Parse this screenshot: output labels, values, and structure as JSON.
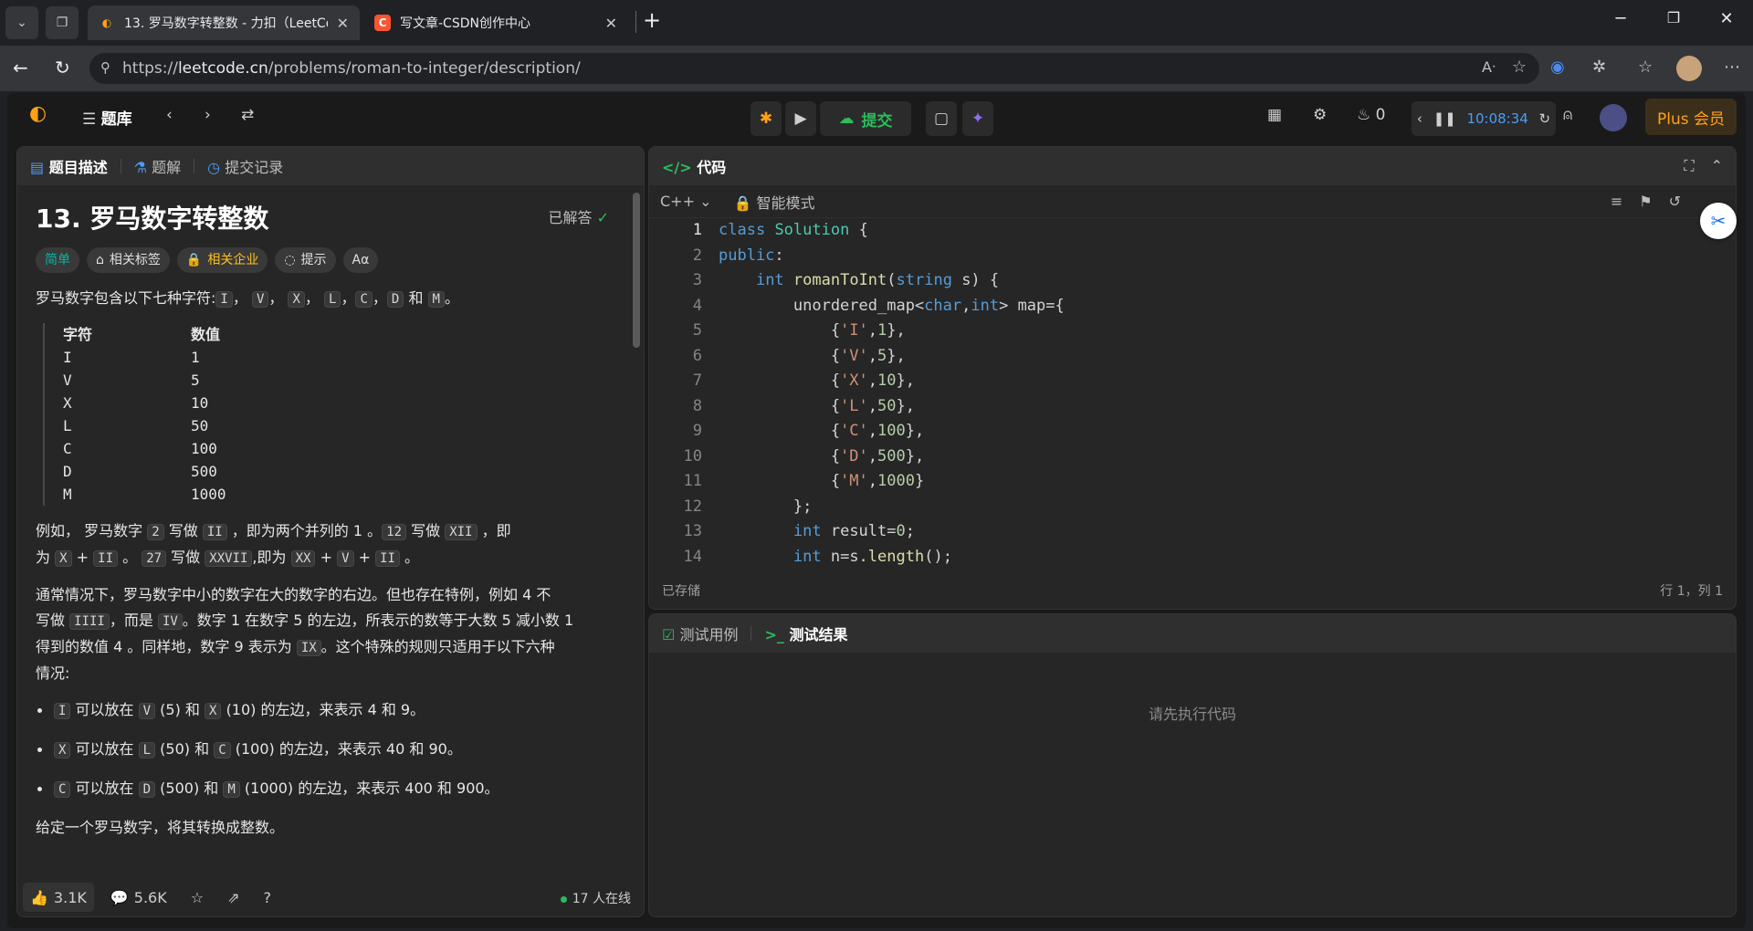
{
  "browser": {
    "tabs": [
      {
        "title": "13. 罗马数字转整数 - 力扣（LeetCode）",
        "icon": "leetcode-icon",
        "active": true
      },
      {
        "title": "写文章-CSDN创作中心",
        "icon": "csdn-icon",
        "active": false
      }
    ],
    "url_prefix": "https://",
    "url_host": "leetcode.cn",
    "url_path": "/problems/roman-to-integer/description/"
  },
  "topnav": {
    "problem_list": "题库",
    "submit_label": "提交",
    "streak_count": "0",
    "timer": "10:08:34",
    "plus_label": "Plus 会员"
  },
  "desc": {
    "tabs": [
      "题目描述",
      "题解",
      "提交记录"
    ],
    "title": "13. 罗马数字转整数",
    "solved": "已解答",
    "tags": [
      "简单",
      "相关标签",
      "相关企业",
      "提示",
      "Aα"
    ],
    "intro_prefix": "罗马数字包含以下七种字符:",
    "intro_chars": [
      "I",
      "V",
      "X",
      "L",
      "C",
      "D",
      "M"
    ],
    "intro_and": "和",
    "intro_end": "。",
    "table_header": [
      "字符",
      "数值"
    ],
    "table_rows": [
      [
        "I",
        "1"
      ],
      [
        "V",
        "5"
      ],
      [
        "X",
        "10"
      ],
      [
        "L",
        "50"
      ],
      [
        "C",
        "100"
      ],
      [
        "D",
        "500"
      ],
      [
        "M",
        "1000"
      ]
    ],
    "ex1_a": "例如，  罗马数字",
    "ex1_2": "2",
    "ex1_b": "写做",
    "ex1_II": "II",
    "ex1_c": "，即为两个并列的 1 。",
    "ex1_12": "12",
    "ex1_d": "写做",
    "ex1_XII": "XII",
    "ex1_e": "，即",
    "ex1_f": "为",
    "ex1_X": "X",
    "ex1_plus": "+",
    "ex1_II2": "II",
    "ex1_g": "。",
    "ex1_27": "27",
    "ex1_h": "写做",
    "ex1_XXVII": "XXVII",
    "ex1_i": ",即为",
    "ex1_XX": "XX",
    "ex1_V": "V",
    "ex1_II3": "II",
    "ex1_j": "。",
    "p2_a": "通常情况下，罗马数字中小的数字在大的数字的右边。但也存在特例，例如 4 不",
    "p2_b": "写做",
    "p2_IIII": "IIII",
    "p2_c": "，而是",
    "p2_IV": "IV",
    "p2_d": "。数字 1 在数字 5 的左边，所表示的数等于大数 5 减小数 1",
    "p2_e": "得到的数值 4 。同样地，数字 9 表示为",
    "p2_IX": "IX",
    "p2_f": "。这个特殊的规则只适用于以下六种",
    "p2_g": "情况:",
    "rules": [
      {
        "a": "I",
        "t1": "可以放在",
        "b": "V",
        "t2": "(5) 和",
        "c": "X",
        "t3": "(10) 的左边，来表示 4 和 9。"
      },
      {
        "a": "X",
        "t1": "可以放在",
        "b": "L",
        "t2": "(50) 和",
        "c": "C",
        "t3": "(100) 的左边，来表示 40 和 90。"
      },
      {
        "a": "C",
        "t1": "可以放在",
        "b": "D",
        "t2": "(500) 和",
        "c": "M",
        "t3": "(1000) 的左边，来表示 400 和 900。"
      }
    ],
    "final": "给定一个罗马数字，将其转换成整数。",
    "likes": "3.1K",
    "comments": "5.6K",
    "online": "17 人在线"
  },
  "editor": {
    "title": "代码",
    "language": "C++",
    "mode": "智能模式",
    "saved": "已存储",
    "cursor": "行 1，列 1"
  },
  "results": {
    "tabs": [
      "测试用例",
      "测试结果"
    ],
    "empty": "请先执行代码"
  },
  "colors": {
    "accent": "#ffa116",
    "easy": "#00b8a3",
    "green": "#2cbb5d"
  }
}
